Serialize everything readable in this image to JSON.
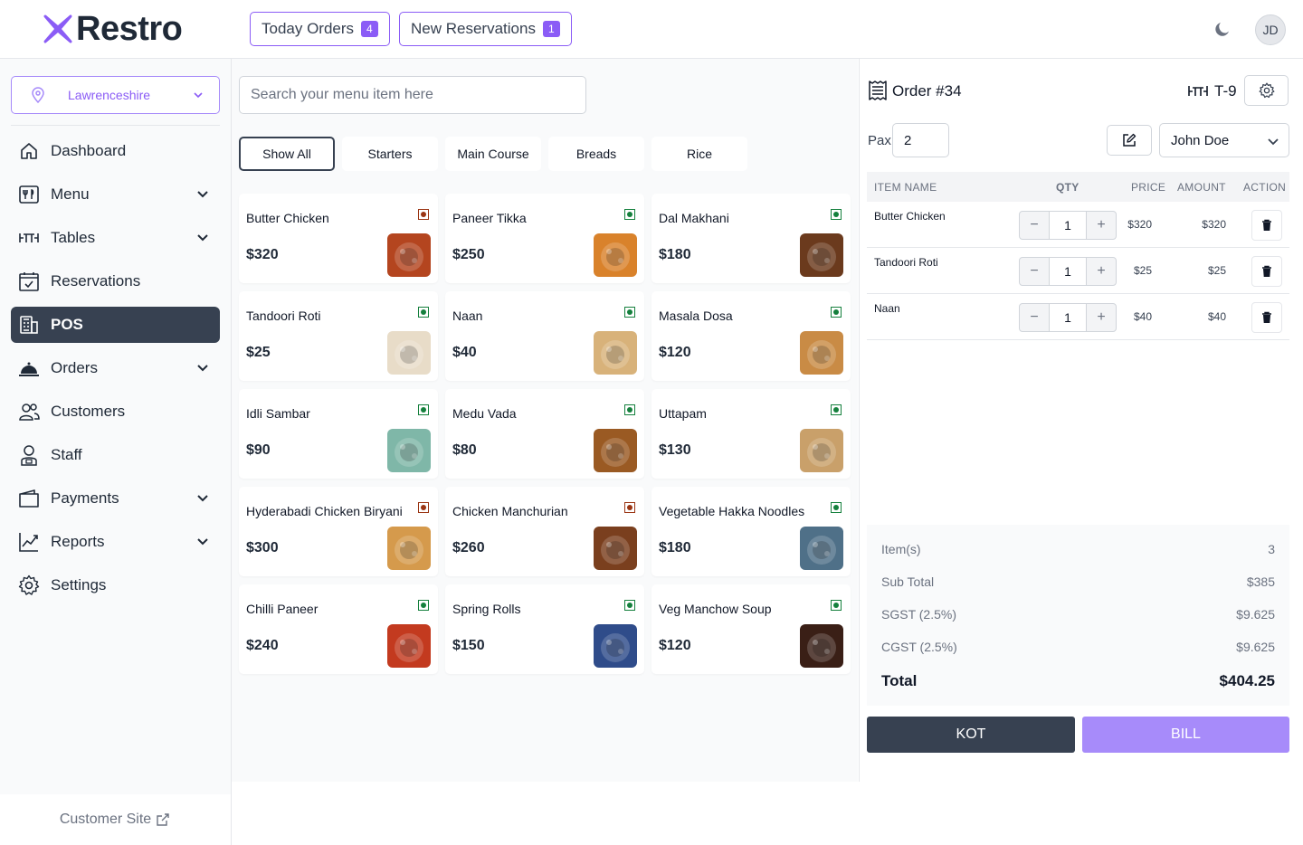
{
  "header": {
    "logo_text": "Restro",
    "today_orders_label": "Today Orders",
    "today_orders_count": "4",
    "new_reservations_label": "New Reservations",
    "new_reservations_count": "1",
    "avatar_initials": "JD",
    "accent_color": "#8b5cf6"
  },
  "sidebar": {
    "location": "Lawrenceshire",
    "items": [
      {
        "label": "Dashboard",
        "icon": "home-icon",
        "has_chevron": false,
        "active": false
      },
      {
        "label": "Menu",
        "icon": "utensils-icon",
        "has_chevron": true,
        "active": false
      },
      {
        "label": "Tables",
        "icon": "table-icon",
        "has_chevron": true,
        "active": false
      },
      {
        "label": "Reservations",
        "icon": "calendar-check-icon",
        "has_chevron": false,
        "active": false
      },
      {
        "label": "POS",
        "icon": "pos-icon",
        "has_chevron": false,
        "active": true
      },
      {
        "label": "Orders",
        "icon": "cloche-icon",
        "has_chevron": true,
        "active": false
      },
      {
        "label": "Customers",
        "icon": "users-icon",
        "has_chevron": false,
        "active": false
      },
      {
        "label": "Staff",
        "icon": "staff-icon",
        "has_chevron": false,
        "active": false
      },
      {
        "label": "Payments",
        "icon": "wallet-icon",
        "has_chevron": true,
        "active": false
      },
      {
        "label": "Reports",
        "icon": "chart-line-icon",
        "has_chevron": true,
        "active": false
      },
      {
        "label": "Settings",
        "icon": "gear-icon",
        "has_chevron": false,
        "active": false
      }
    ],
    "footer_link": "Customer Site"
  },
  "menu": {
    "search_placeholder": "Search your menu item here",
    "categories": [
      {
        "label": "Show All",
        "active": true
      },
      {
        "label": "Starters",
        "active": false
      },
      {
        "label": "Main Course",
        "active": false
      },
      {
        "label": "Breads",
        "active": false
      },
      {
        "label": "Rice",
        "active": false
      }
    ],
    "items": [
      {
        "name": "Butter Chicken",
        "price": "$320",
        "veg": false,
        "thumb_color": "#b4451f"
      },
      {
        "name": "Paneer Tikka",
        "price": "$250",
        "veg": true,
        "thumb_color": "#d9822b"
      },
      {
        "name": "Dal Makhani",
        "price": "$180",
        "veg": true,
        "thumb_color": "#6b3a1d"
      },
      {
        "name": "Tandoori Roti",
        "price": "$25",
        "veg": true,
        "thumb_color": "#e8dcc8"
      },
      {
        "name": "Naan",
        "price": "$40",
        "veg": true,
        "thumb_color": "#d8b27a"
      },
      {
        "name": "Masala Dosa",
        "price": "$120",
        "veg": true,
        "thumb_color": "#c98b45"
      },
      {
        "name": "Idli Sambar",
        "price": "$90",
        "veg": true,
        "thumb_color": "#7fb7a8"
      },
      {
        "name": "Medu Vada",
        "price": "$80",
        "veg": true,
        "thumb_color": "#9a5a23"
      },
      {
        "name": "Uttapam",
        "price": "$130",
        "veg": true,
        "thumb_color": "#c9a06a"
      },
      {
        "name": "Hyderabadi Chicken Biryani",
        "price": "$300",
        "veg": false,
        "thumb_color": "#d59a4c"
      },
      {
        "name": "Chicken Manchurian",
        "price": "$260",
        "veg": false,
        "thumb_color": "#7a3f1e"
      },
      {
        "name": "Vegetable Hakka Noodles",
        "price": "$180",
        "veg": true,
        "thumb_color": "#4f7088"
      },
      {
        "name": "Chilli Paneer",
        "price": "$240",
        "veg": true,
        "thumb_color": "#c33a1f"
      },
      {
        "name": "Spring Rolls",
        "price": "$150",
        "veg": true,
        "thumb_color": "#2f4c8a"
      },
      {
        "name": "Veg Manchow Soup",
        "price": "$120",
        "veg": true,
        "thumb_color": "#3a1f16"
      }
    ],
    "veg_color": "#15803d",
    "nonveg_color": "#9a3412"
  },
  "order": {
    "title": "Order #34",
    "table": "T-9",
    "pax_label": "Pax",
    "pax_value": "2",
    "waiter": "John Doe",
    "columns": {
      "item": "Item Name",
      "qty": "QTY",
      "price": "Price",
      "amount": "Amount",
      "action": "Action"
    },
    "rows": [
      {
        "name": "Butter Chicken",
        "qty": "1",
        "price": "$320",
        "amount": "$320"
      },
      {
        "name": "Tandoori Roti",
        "qty": "1",
        "price": "$25",
        "amount": "$25"
      },
      {
        "name": "Naan",
        "qty": "1",
        "price": "$40",
        "amount": "$40"
      }
    ],
    "summary": {
      "items_label": "Item(s)",
      "items_value": "3",
      "subtotal_label": "Sub Total",
      "subtotal_value": "$385",
      "sgst_label": "SGST (2.5%)",
      "sgst_value": "$9.625",
      "cgst_label": "CGST (2.5%)",
      "cgst_value": "$9.625",
      "total_label": "Total",
      "total_value": "$404.25"
    },
    "kot_label": "KOT",
    "bill_label": "BILL"
  }
}
